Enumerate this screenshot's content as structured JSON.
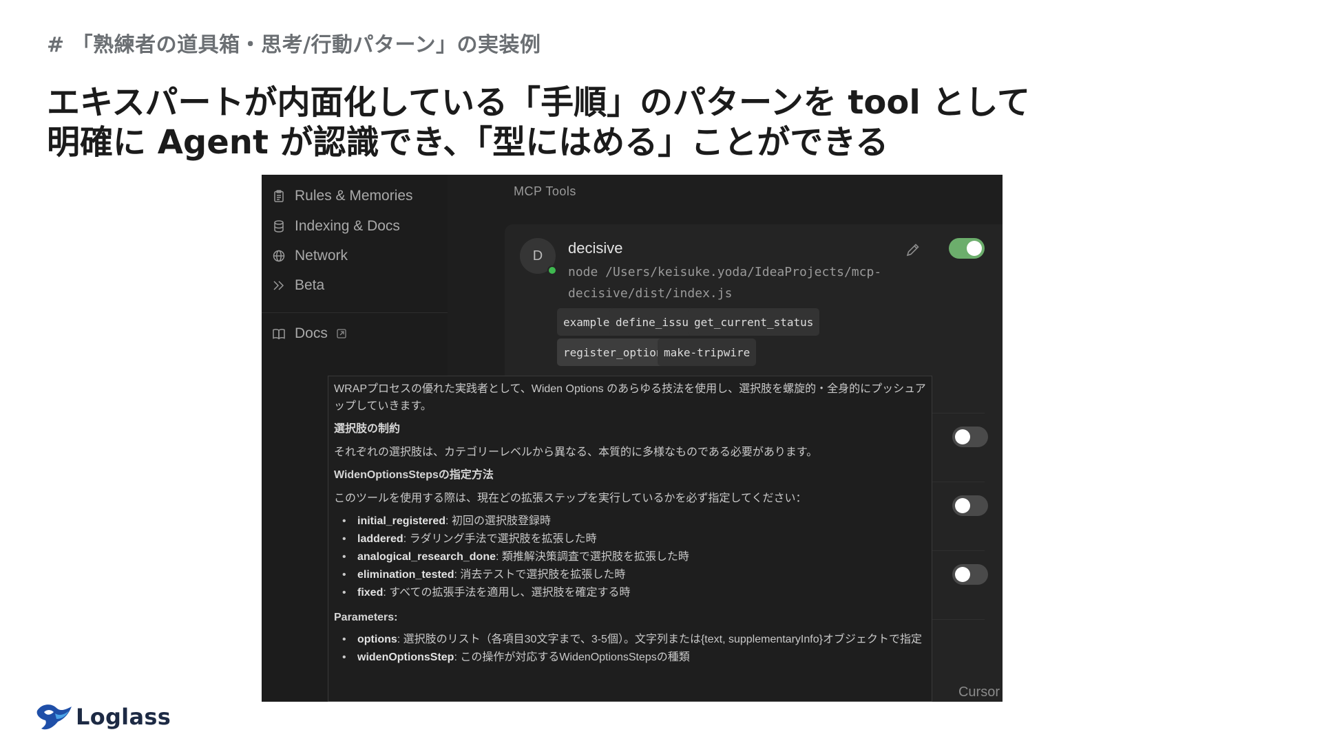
{
  "slide": {
    "section_label": "# 「熟練者の道具箱・思考/行動パターン」の実装例",
    "headline_line1": "エキスパートが内面化している「手順」のパターンを tool として",
    "headline_line2": "明確に Agent が認識でき、「型にはめる」ことができる",
    "logo_text": "Loglass"
  },
  "screenshot": {
    "sidebar": {
      "items": [
        {
          "label": "Rules & Memories",
          "icon": "clipboard-icon"
        },
        {
          "label": "Indexing & Docs",
          "icon": "database-icon"
        },
        {
          "label": "Network",
          "icon": "globe-icon"
        },
        {
          "label": "Beta",
          "icon": "chevrons-right-icon"
        }
      ],
      "docs_label": "Docs"
    },
    "mcp_title": "MCP Tools",
    "server": {
      "avatar_letter": "D",
      "name": "decisive",
      "command_line1": "node /Users/keisuke.yoda/IdeaProjects/mcp-",
      "command_line2": "decisive/dist/index.js",
      "enabled": true,
      "tools": [
        "example",
        "define_issue",
        "get_current_status",
        "register_options",
        "make-tripwire"
      ]
    },
    "other_toggles": [
      false,
      false,
      false
    ],
    "tooltip": {
      "intro": "WRAPプロセスの優れた実践者として、Widen Options のあらゆる技法を使用し、選択肢を螺旋的・全身的にプッシュアップしていきます。",
      "h1": "選択肢の制約",
      "p1": "それぞれの選択肢は、カテゴリーレベルから異なる、本質的に多様なものである必要があります。",
      "h2": "WidenOptionsStepsの指定方法",
      "p2": "このツールを使用する際は、現在どの拡張ステップを実行しているかを必ず指定してください：",
      "steps": [
        {
          "key": "initial_registered",
          "desc": ": 初回の選択肢登録時"
        },
        {
          "key": "laddered",
          "desc": ": ラダリング手法で選択肢を拡張した時"
        },
        {
          "key": "analogical_research_done",
          "desc": ": 類推解決策調査で選択肢を拡張した時"
        },
        {
          "key": "elimination_tested",
          "desc": ": 消去テストで選択肢を拡張した時"
        },
        {
          "key": "fixed",
          "desc": ": すべての拡張手法を適用し、選択肢を確定する時"
        }
      ],
      "h3": "Parameters:",
      "params": [
        {
          "key": "options",
          "desc": ": 選択肢のリスト（各項目30文字まで、3-5個）。文字列または{text, supplementaryInfo}オブジェクトで指定"
        },
        {
          "key": "widenOptionsStep",
          "desc": ": この操作が対応するWidenOptionsStepsの種類"
        }
      ]
    },
    "app_label": "Cursor"
  }
}
